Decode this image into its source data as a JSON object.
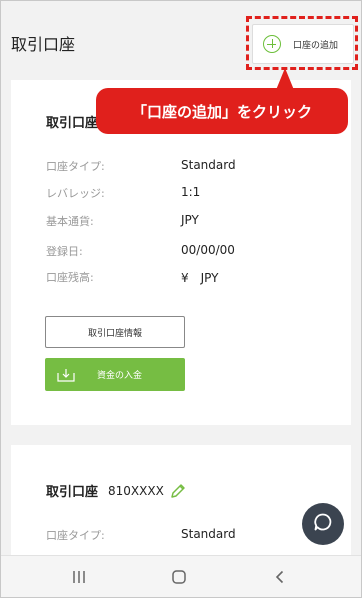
{
  "header": {
    "title": "取引口座",
    "add_account_label": "口座の追加"
  },
  "callout": {
    "text": "「口座の追加」をクリック",
    "color": "#e0201c"
  },
  "account_card_1": {
    "title": "取引口座",
    "details": [
      {
        "label": "口座タイプ:",
        "value": "Standard"
      },
      {
        "label": "レバレッジ:",
        "value": "1:1"
      },
      {
        "label": "基本通貨:",
        "value": "JPY"
      },
      {
        "label": "登録日:",
        "value": "00/00/00"
      },
      {
        "label": "口座残高:",
        "value": "¥　JPY"
      }
    ],
    "info_button_label": "取引口座情報",
    "deposit_button_label": "資金の入金"
  },
  "account_card_2": {
    "title": "取引口座",
    "account_number": "810XXXX",
    "details": [
      {
        "label": "口座タイプ:",
        "value": "Standard"
      }
    ]
  },
  "icons": {
    "add": "plus-circle-icon",
    "edit": "pencil-icon",
    "deposit": "deposit-icon",
    "chat": "chat-icon",
    "nav_recents": "recents-icon",
    "nav_home": "home-icon",
    "nav_back": "back-icon"
  },
  "colors": {
    "accent_green": "#76bd43",
    "highlight_red": "#e0201c",
    "fab": "#3b4450"
  }
}
